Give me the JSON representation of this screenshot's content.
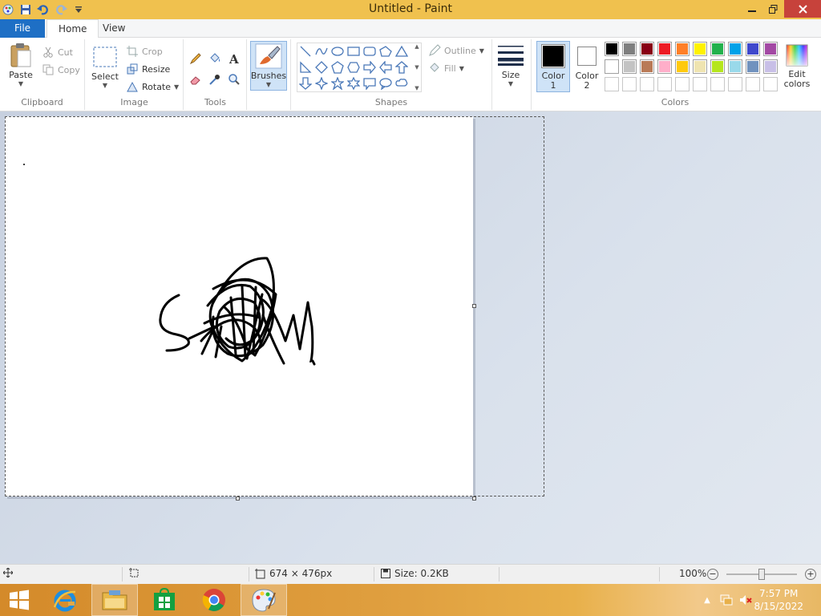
{
  "window": {
    "title": "Untitled - Paint"
  },
  "tabs": {
    "file": "File",
    "home": "Home",
    "view": "View"
  },
  "clipboard": {
    "paste": "Paste",
    "cut": "Cut",
    "copy": "Copy",
    "label": "Clipboard"
  },
  "image": {
    "select": "Select",
    "crop": "Crop",
    "resize": "Resize",
    "rotate": "Rotate",
    "label": "Image"
  },
  "tools": {
    "label": "Tools",
    "brushes": "Brushes"
  },
  "shapes": {
    "outline": "Outline",
    "fill": "Fill",
    "label": "Shapes"
  },
  "size": {
    "label": "Size"
  },
  "colors": {
    "color1_line1": "Color",
    "color1_line2": "1",
    "color2_line1": "Color",
    "color2_line2": "2",
    "edit_line1": "Edit",
    "edit_line2": "colors",
    "label": "Colors",
    "color1_value": "#000000",
    "color2_value": "#ffffff",
    "palette_row1": [
      "#000000",
      "#7f7f7f",
      "#880015",
      "#ed1c24",
      "#ff7f27",
      "#fff200",
      "#22b14c",
      "#00a2e8",
      "#3f48cc",
      "#a349a4"
    ],
    "palette_row2": [
      "#ffffff",
      "#c3c3c3",
      "#b97a57",
      "#ffaec9",
      "#ffc90e",
      "#efe4b0",
      "#b5e61d",
      "#99d9ea",
      "#7092be",
      "#c8bfe7"
    ],
    "palette_row3": [
      "#ffffff",
      "#ffffff",
      "#ffffff",
      "#ffffff",
      "#ffffff",
      "#ffffff",
      "#ffffff",
      "#ffffff",
      "#ffffff",
      "#ffffff"
    ]
  },
  "status": {
    "dimensions": "674 × 476px",
    "size": "Size: 0.2KB",
    "zoom": "100%"
  },
  "taskbar": {
    "time": "7:57 PM",
    "date": "8/15/2022"
  }
}
